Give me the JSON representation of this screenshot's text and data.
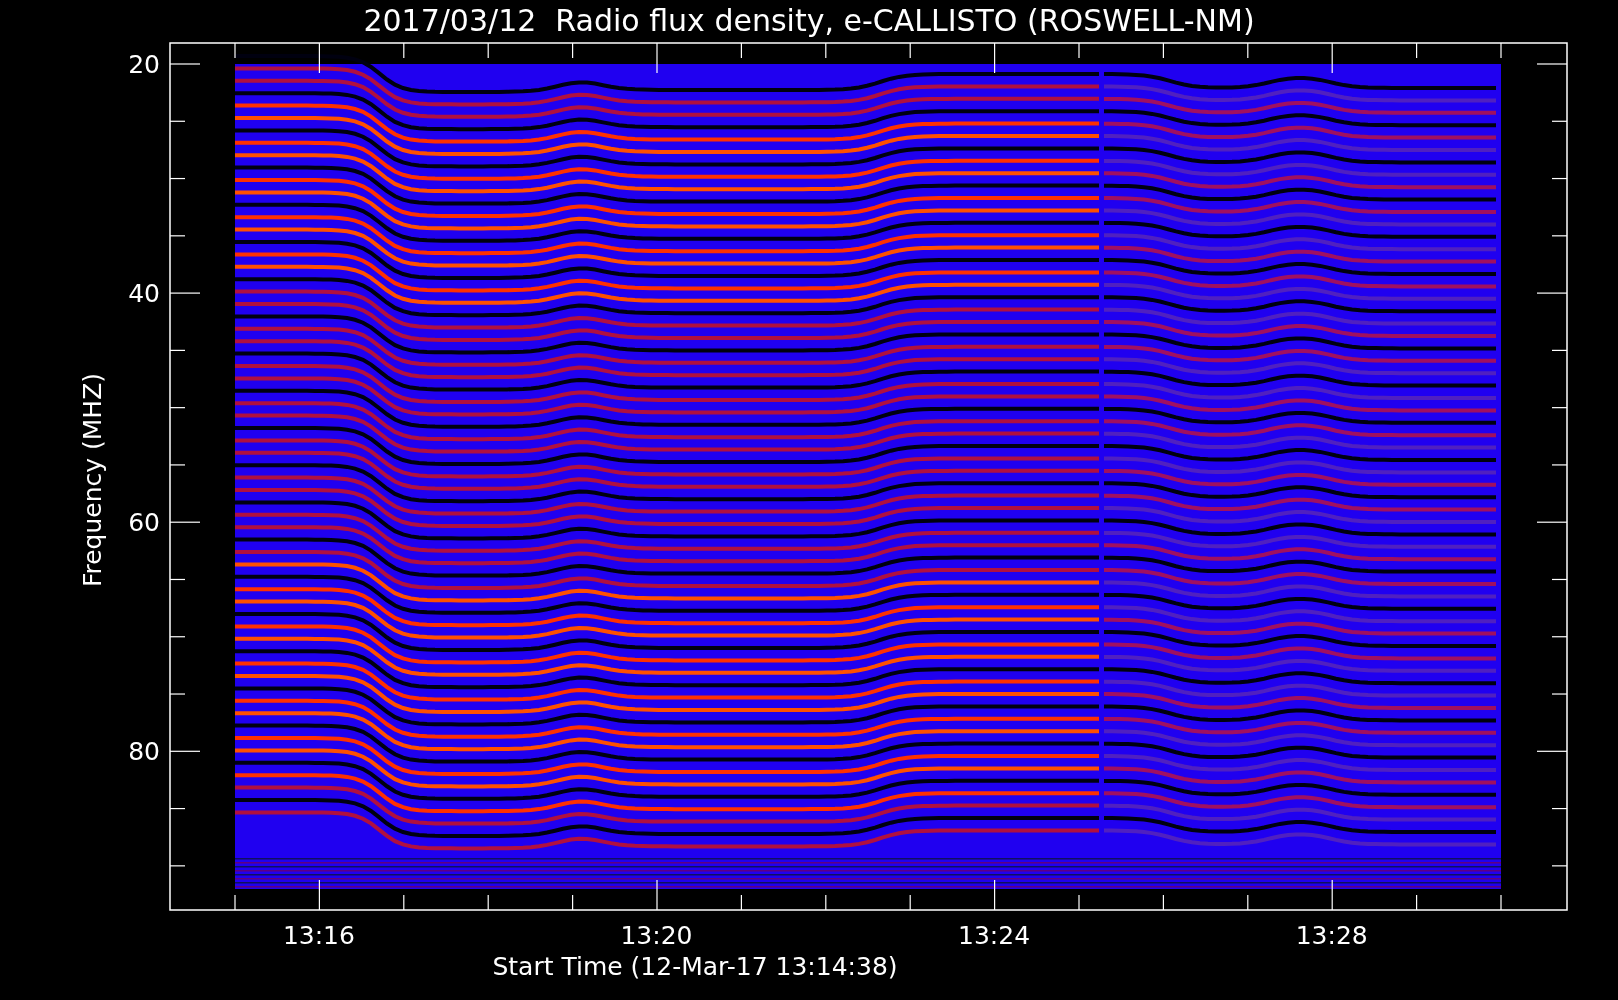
{
  "title": "2017/03/12  Radio flux density, e-CALLISTO (ROSWELL-NM)",
  "ylabel": "Frequency (MHZ)",
  "xlabel": "Start Time (12-Mar-17 13:14:38)",
  "yticks": [
    "20",
    "40",
    "60",
    "80"
  ],
  "xticks": [
    "13:16",
    "13:20",
    "13:24",
    "13:28"
  ]
}
